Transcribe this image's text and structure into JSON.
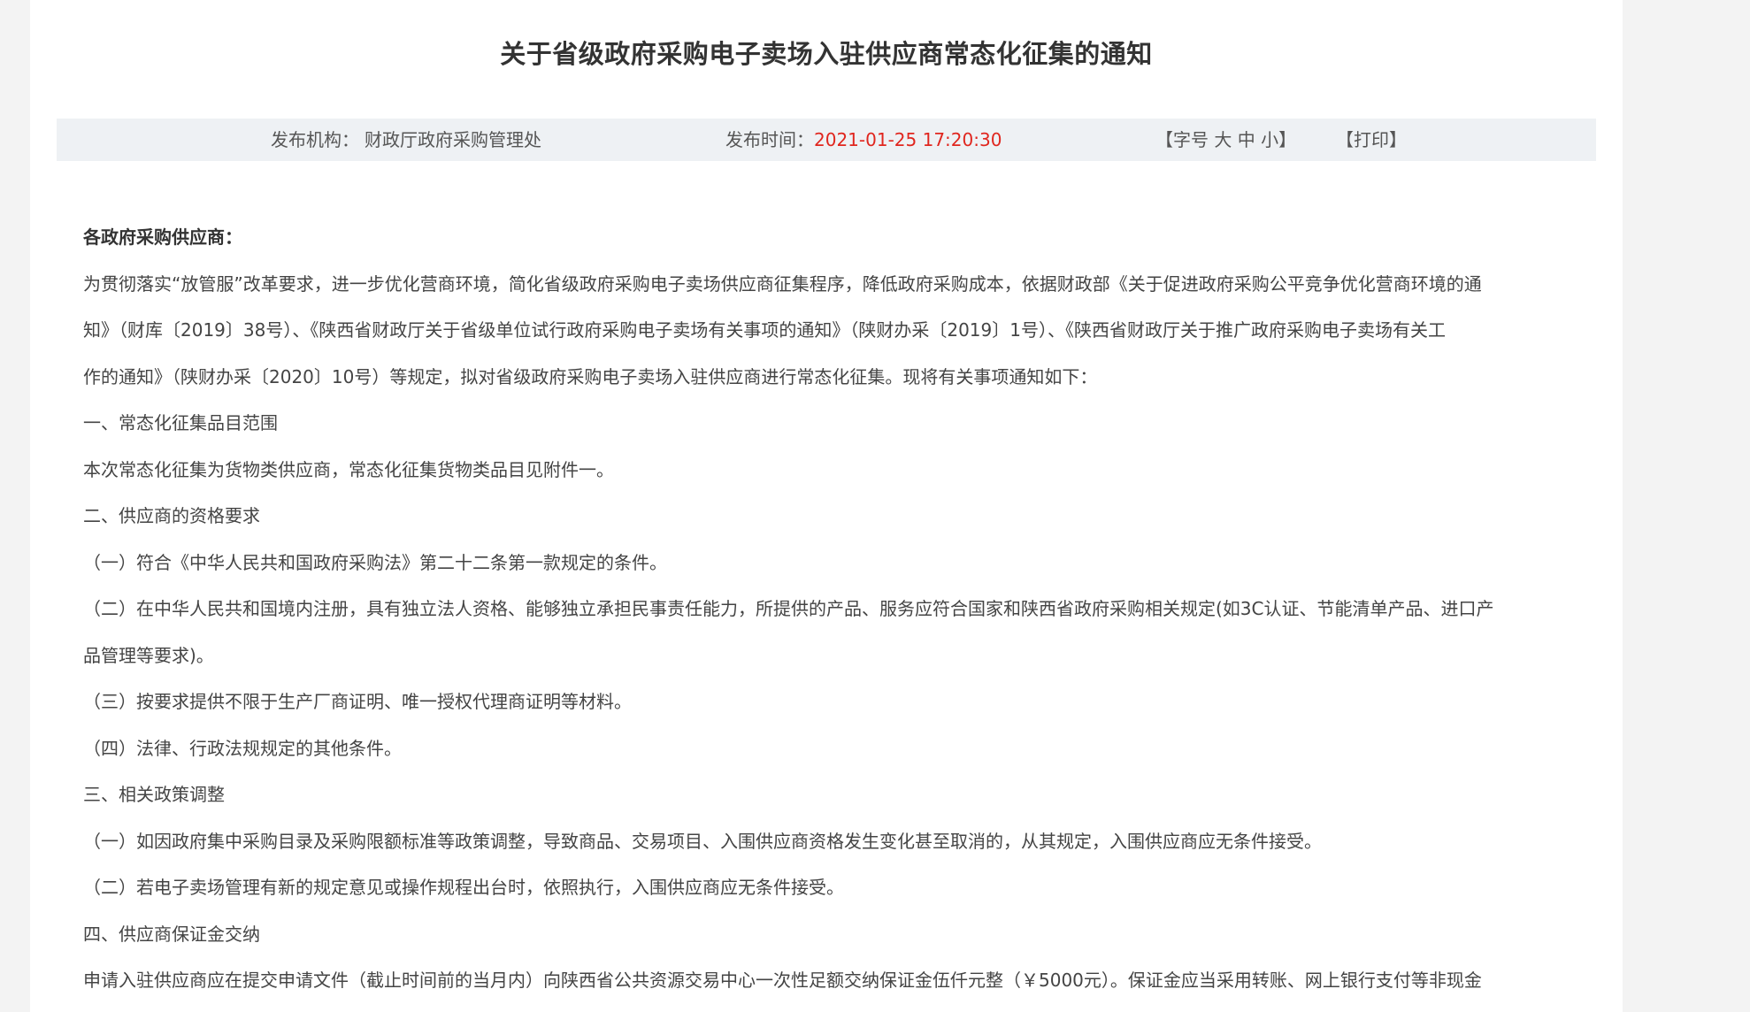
{
  "article": {
    "title": "关于省级政府采购电子卖场入驻供应商常态化征集的通知"
  },
  "meta": {
    "org_label": "发布机构：",
    "org_value": "财政厅政府采购管理处",
    "time_label": "发布时间：",
    "time_value": "2021-01-25 17:20:30",
    "font_open": "【字号",
    "font_large": "大",
    "font_medium": "中",
    "font_small": "小",
    "font_close": "】",
    "print": "【打印】"
  },
  "body": {
    "salutation": "各政府采购供应商：",
    "paragraphs": [
      "为贯彻落实“放管服”改革要求，进一步优化营商环境，简化省级政府采购电子卖场供应商征集程序，降低政府采购成本，依据财政部《关于促进政府采购公平竞争优化营商环境的通",
      "知》（财库〔2019〕38号）、《陕西省财政厅关于省级单位试行政府采购电子卖场有关事项的通知》（陕财办采〔2019〕1号）、《陕西省财政厅关于推广政府采购电子卖场有关工",
      "作的通知》（陕财办采〔2020〕10号）等规定，拟对省级政府采购电子卖场入驻供应商进行常态化征集。现将有关事项通知如下：",
      "一、常态化征集品目范围",
      "本次常态化征集为货物类供应商，常态化征集货物类品目见附件一。",
      "二、供应商的资格要求",
      "（一）符合《中华人民共和国政府采购法》第二十二条第一款规定的条件。",
      "（二）在中华人民共和国境内注册，具有独立法人资格、能够独立承担民事责任能力，所提供的产品、服务应符合国家和陕西省政府采购相关规定(如3C认证、节能清单产品、进口产",
      "品管理等要求)。",
      "（三）按要求提供不限于生产厂商证明、唯一授权代理商证明等材料。",
      "（四）法律、行政法规规定的其他条件。",
      "三、相关政策调整",
      "（一）如因政府集中采购目录及采购限额标准等政策调整，导致商品、交易项目、入围供应商资格发生变化甚至取消的，从其规定，入围供应商应无条件接受。",
      "（二）若电子卖场管理有新的规定意见或操作规程出台时，依照执行，入围供应商应无条件接受。",
      "四、供应商保证金交纳",
      "申请入驻供应商应在提交申请文件（截止时间前的当月内）向陕西省公共资源交易中心一次性足额交纳保证金伍仟元整（￥5000元）。保证金应当采用转账、网上银行支付等非现金"
    ]
  }
}
